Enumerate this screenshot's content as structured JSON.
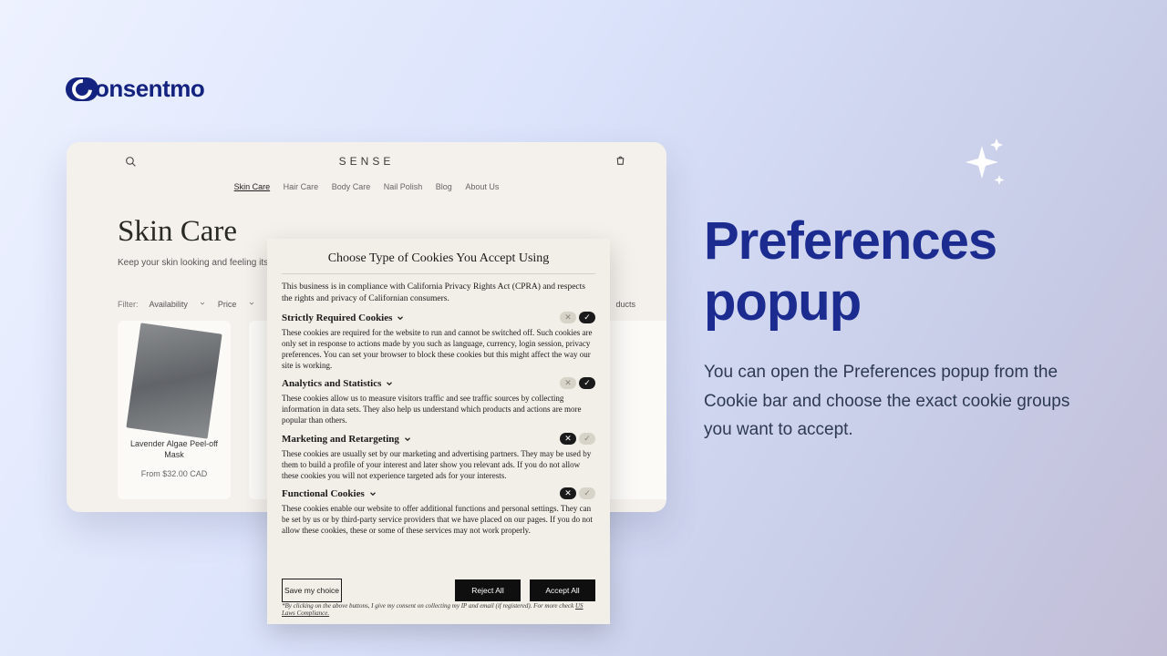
{
  "logo_text": "onsentmo",
  "promo": {
    "heading": "Preferences popup",
    "body": "You can open the Preferences popup from the Cookie bar and choose the exact cookie groups you want to accept."
  },
  "site": {
    "brand": "SENSE",
    "nav": [
      "Skin Care",
      "Hair Care",
      "Body Care",
      "Nail Polish",
      "Blog",
      "About Us"
    ],
    "page_title": "Skin Care",
    "page_sub": "Keep your skin looking and feeling its",
    "filter_label": "Filter:",
    "filter_availability": "Availability",
    "filter_price": "Price",
    "sort_products": "ducts",
    "product": {
      "name": "Lavender Algae Peel-off Mask",
      "price": "From $32.00 CAD"
    }
  },
  "popup": {
    "title": "Choose Type of Cookies You Accept Using",
    "intro": "This business is in compliance with California Privacy Rights Act (CPRA) and respects the rights and privacy of Californian consumers.",
    "cats": [
      {
        "title": "Strictly Required Cookies",
        "body": "These cookies are required for the website to run and cannot be switched off. Such cookies are only set in response to actions made by you such as language, currency, login session, privacy preferences. You can set your browser to block these cookies but this might affect the way our site is working.",
        "on": true
      },
      {
        "title": "Analytics and Statistics",
        "body": "These cookies allow us to measure visitors traffic and see traffic sources by collecting information in data sets. They also help us understand which products and actions are more popular than others.",
        "on": true
      },
      {
        "title": "Marketing and Retargeting",
        "body": "These cookies are usually set by our marketing and advertising partners. They may be used by them to build a profile of your interest and later show you relevant ads. If you do not allow these cookies you will not experience targeted ads for your interests.",
        "on": false
      },
      {
        "title": "Functional Cookies",
        "body": "These cookies enable our website to offer additional functions and personal settings. They can be set by us or by third-party service providers that we have placed on our pages. If you do not allow these cookies, these or some of these services may not work properly.",
        "on": false
      }
    ],
    "btn_save": "Save my choice",
    "btn_reject": "Reject All",
    "btn_accept": "Accept All",
    "footnote_pre": "*By clicking on the above buttons, I give my consent on collecting my IP and email (if registered). For more check ",
    "footnote_link": "US Laws Compliance."
  }
}
